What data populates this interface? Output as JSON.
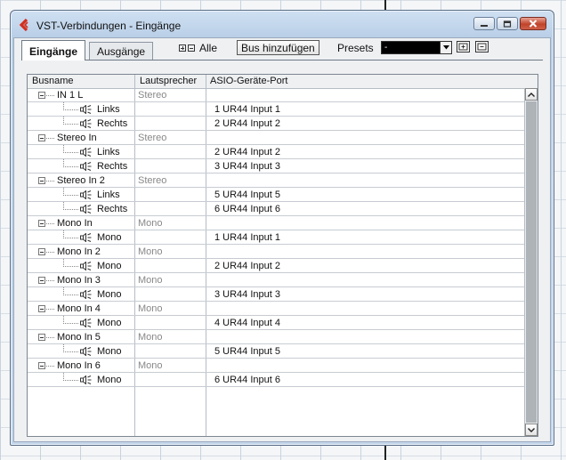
{
  "window": {
    "title": "VST-Verbindungen - Eingänge"
  },
  "tabs": [
    {
      "label": "Eingänge",
      "active": true
    },
    {
      "label": "Ausgänge",
      "active": false
    }
  ],
  "toolbar": {
    "all_label": "Alle",
    "add_bus_label": "Bus hinzufügen",
    "presets_label": "Presets",
    "presets_value": "-"
  },
  "table": {
    "columns": [
      "Busname",
      "Lautsprecher",
      "ASIO-Geräte-Port"
    ],
    "rows": [
      {
        "name": "IN 1 L",
        "speaker": "Stereo",
        "port": "",
        "child": false
      },
      {
        "name": "Links",
        "speaker": "",
        "port": "1 UR44 Input 1",
        "child": true
      },
      {
        "name": "Rechts",
        "speaker": "",
        "port": "2 UR44 Input 2",
        "child": true
      },
      {
        "name": "Stereo In",
        "speaker": "Stereo",
        "port": "",
        "child": false
      },
      {
        "name": "Links",
        "speaker": "",
        "port": "2 UR44 Input 2",
        "child": true
      },
      {
        "name": "Rechts",
        "speaker": "",
        "port": "3 UR44 Input 3",
        "child": true
      },
      {
        "name": "Stereo In 2",
        "speaker": "Stereo",
        "port": "",
        "child": false
      },
      {
        "name": "Links",
        "speaker": "",
        "port": "5 UR44 Input 5",
        "child": true
      },
      {
        "name": "Rechts",
        "speaker": "",
        "port": "6 UR44 Input 6",
        "child": true
      },
      {
        "name": "Mono In",
        "speaker": "Mono",
        "port": "",
        "child": false
      },
      {
        "name": "Mono",
        "speaker": "",
        "port": "1 UR44 Input 1",
        "child": true
      },
      {
        "name": "Mono In 2",
        "speaker": "Mono",
        "port": "",
        "child": false
      },
      {
        "name": "Mono",
        "speaker": "",
        "port": "2 UR44 Input 2",
        "child": true
      },
      {
        "name": "Mono In 3",
        "speaker": "Mono",
        "port": "",
        "child": false
      },
      {
        "name": "Mono",
        "speaker": "",
        "port": "3 UR44 Input 3",
        "child": true
      },
      {
        "name": "Mono In 4",
        "speaker": "Mono",
        "port": "",
        "child": false
      },
      {
        "name": "Mono",
        "speaker": "",
        "port": "4 UR44 Input 4",
        "child": true
      },
      {
        "name": "Mono In 5",
        "speaker": "Mono",
        "port": "",
        "child": false
      },
      {
        "name": "Mono",
        "speaker": "",
        "port": "5 UR44 Input 5",
        "child": true
      },
      {
        "name": "Mono In 6",
        "speaker": "Mono",
        "port": "",
        "child": false
      },
      {
        "name": "Mono",
        "speaker": "",
        "port": "6 UR44 Input 6",
        "child": true
      }
    ]
  },
  "colors": {
    "accent_logo": "#d32f1f",
    "close_button": "#c0432a"
  },
  "icons": [
    "app-logo-icon",
    "minimize-icon",
    "maximize-icon",
    "close-icon",
    "expand-all-icon",
    "collapse-all-icon",
    "dropdown-arrow-icon",
    "store-preset-icon",
    "remove-preset-icon",
    "collapse-tree-icon",
    "speaker-icon",
    "scroll-up-icon",
    "scroll-down-icon"
  ]
}
